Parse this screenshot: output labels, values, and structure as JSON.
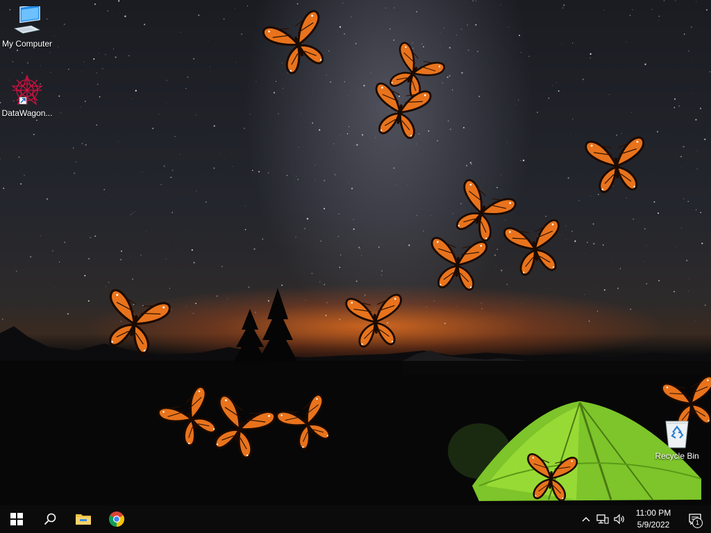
{
  "desktop": {
    "icons": [
      {
        "label": "My Computer",
        "icon": "computer-icon"
      },
      {
        "label": "DataWagon...",
        "icon": "datawagon-shortcut-icon"
      },
      {
        "label": "Recycle Bin",
        "icon": "recycle-bin-icon"
      }
    ],
    "wallpaper": "night-sky-camping-tent-with-butterflies"
  },
  "taskbar": {
    "start": {
      "icon": "windows-start-icon"
    },
    "search": {
      "icon": "search-icon"
    },
    "pinned": [
      {
        "name": "File Explorer",
        "icon": "folder-icon"
      },
      {
        "name": "Google Chrome",
        "icon": "chrome-icon"
      }
    ],
    "tray": {
      "icons": [
        "chevron-up-icon",
        "network-icon",
        "volume-icon"
      ],
      "time": "11:00 PM",
      "date": "5/9/2022",
      "notifications": {
        "icon": "action-center-icon",
        "count": "1"
      }
    }
  },
  "colors": {
    "butterfly_orange": "#e8731c",
    "tent_green": "#8fd12a",
    "taskbar": "#0b0b0c"
  }
}
